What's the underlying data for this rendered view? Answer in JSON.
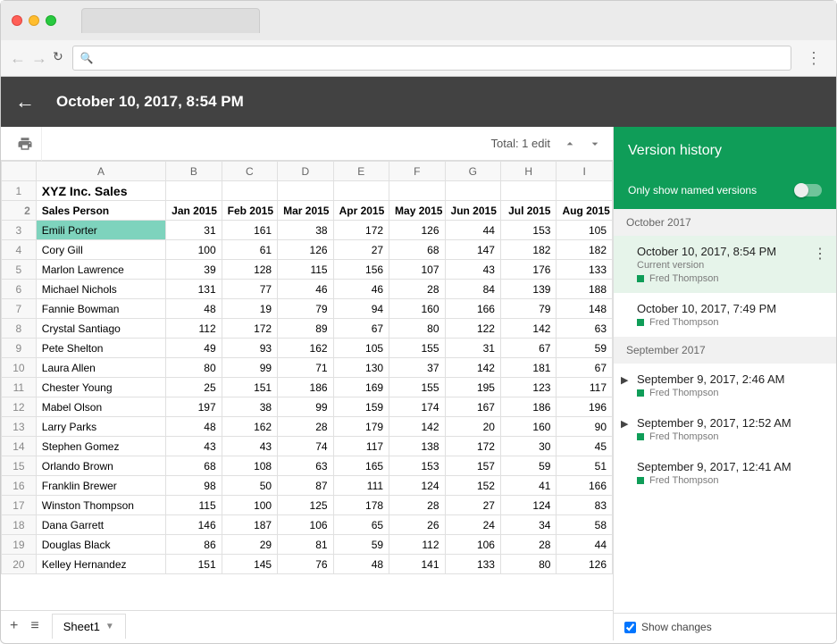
{
  "header": {
    "title": "October 10, 2017, 8:54 PM",
    "edits_info": "Total: 1 edit"
  },
  "sheet": {
    "title": "XYZ Inc. Sales",
    "columns_letters": [
      "A",
      "B",
      "C",
      "D",
      "E",
      "F",
      "G",
      "H",
      "I"
    ],
    "header_row": [
      "Sales Person",
      "Jan 2015",
      "Feb 2015",
      "Mar 2015",
      "Apr 2015",
      "May 2015",
      "Jun 2015",
      "Jul 2015",
      "Aug 2015"
    ],
    "rows": [
      {
        "name": "Emili Porter",
        "vals": [
          31,
          161,
          38,
          172,
          126,
          44,
          153,
          105
        ],
        "hl": true
      },
      {
        "name": "Cory Gill",
        "vals": [
          100,
          61,
          126,
          27,
          68,
          147,
          182,
          182
        ]
      },
      {
        "name": "Marlon Lawrence",
        "vals": [
          39,
          128,
          115,
          156,
          107,
          43,
          176,
          133
        ]
      },
      {
        "name": "Michael Nichols",
        "vals": [
          131,
          77,
          46,
          46,
          28,
          84,
          139,
          188
        ]
      },
      {
        "name": "Fannie Bowman",
        "vals": [
          48,
          19,
          79,
          94,
          160,
          166,
          79,
          148
        ]
      },
      {
        "name": "Crystal Santiago",
        "vals": [
          112,
          172,
          89,
          67,
          80,
          122,
          142,
          63
        ]
      },
      {
        "name": "Pete Shelton",
        "vals": [
          49,
          93,
          162,
          105,
          155,
          31,
          67,
          59
        ]
      },
      {
        "name": "Laura Allen",
        "vals": [
          80,
          99,
          71,
          130,
          37,
          142,
          181,
          67
        ]
      },
      {
        "name": "Chester Young",
        "vals": [
          25,
          151,
          186,
          169,
          155,
          195,
          123,
          117
        ]
      },
      {
        "name": "Mabel Olson",
        "vals": [
          197,
          38,
          99,
          159,
          174,
          167,
          186,
          196
        ]
      },
      {
        "name": "Larry Parks",
        "vals": [
          48,
          162,
          28,
          179,
          142,
          20,
          160,
          90
        ]
      },
      {
        "name": "Stephen Gomez",
        "vals": [
          43,
          43,
          74,
          117,
          138,
          172,
          30,
          45
        ]
      },
      {
        "name": "Orlando Brown",
        "vals": [
          68,
          108,
          63,
          165,
          153,
          157,
          59,
          51
        ]
      },
      {
        "name": "Franklin Brewer",
        "vals": [
          98,
          50,
          87,
          111,
          124,
          152,
          41,
          166
        ]
      },
      {
        "name": "Winston Thompson",
        "vals": [
          115,
          100,
          125,
          178,
          28,
          27,
          124,
          83
        ]
      },
      {
        "name": "Dana Garrett",
        "vals": [
          146,
          187,
          106,
          65,
          26,
          24,
          34,
          58
        ]
      },
      {
        "name": "Douglas Black",
        "vals": [
          86,
          29,
          81,
          59,
          112,
          106,
          28,
          44
        ]
      },
      {
        "name": "Kelley Hernandez",
        "vals": [
          151,
          145,
          76,
          48,
          141,
          133,
          80,
          126
        ]
      }
    ],
    "tab_name": "Sheet1"
  },
  "side": {
    "title": "Version history",
    "toggle_label": "Only show named versions",
    "show_changes_label": "Show changes",
    "groups": [
      {
        "month": "October 2017",
        "items": [
          {
            "time": "October 10, 2017, 8:54 PM",
            "sub": "Current version",
            "author": "Fred Thompson",
            "selected": true,
            "dots": true
          },
          {
            "time": "October 10, 2017, 7:49 PM",
            "author": "Fred Thompson"
          }
        ]
      },
      {
        "month": "September 2017",
        "items": [
          {
            "time": "September 9, 2017, 2:46 AM",
            "author": "Fred Thompson",
            "expand": true
          },
          {
            "time": "September 9, 2017, 12:52 AM",
            "author": "Fred Thompson",
            "expand": true
          },
          {
            "time": "September 9, 2017, 12:41 AM",
            "author": "Fred Thompson"
          }
        ]
      }
    ]
  }
}
